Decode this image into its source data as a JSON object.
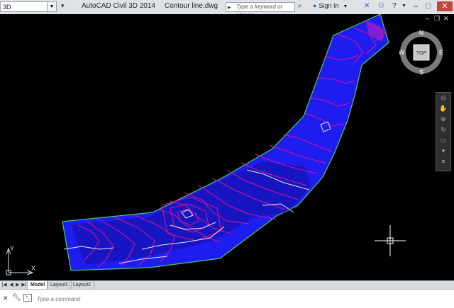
{
  "titlebar": {
    "workspace": "3D",
    "app_title": "AutoCAD Civil 3D 2014",
    "doc_title": "Contour line.dwg",
    "search_placeholder": "Type a keyword or phrase",
    "signin_label": "Sign In"
  },
  "viewcube": {
    "north": "N",
    "south": "S",
    "east": "E",
    "west": "W",
    "face": "TOP"
  },
  "ucs": {
    "x_label": "X",
    "y_label": "Y"
  },
  "layout_tabs": [
    {
      "label": "Model",
      "active": true
    },
    {
      "label": "Layout1",
      "active": false
    },
    {
      "label": "Layout2",
      "active": false
    }
  ],
  "command": {
    "placeholder": "Type a command",
    "prompt_icon": ">_"
  },
  "colors": {
    "surface_fill": "#1f1cf0",
    "boundary": "#3fcf6a",
    "major_contour": "#e8e8e8",
    "minor_contour": "#e0109b",
    "background": "#000000"
  },
  "icons": {
    "search": "search-icon",
    "signin": "user-icon",
    "exchange": "exchange-icon",
    "network": "network-icon",
    "help": "help-icon"
  }
}
